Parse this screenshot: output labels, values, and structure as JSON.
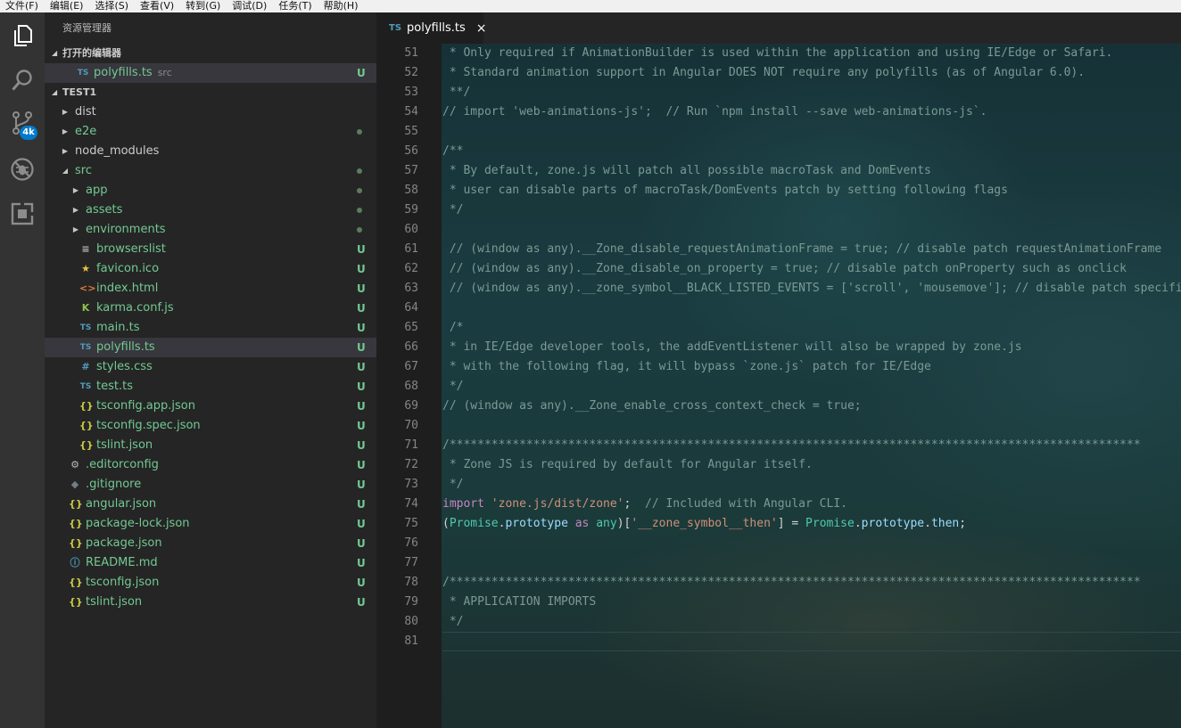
{
  "menu": [
    "文件(F)",
    "编辑(E)",
    "选择(S)",
    "查看(V)",
    "转到(G)",
    "调试(D)",
    "任务(T)",
    "帮助(H)"
  ],
  "activity_bar": {
    "items": [
      {
        "name": "explorer-icon"
      },
      {
        "name": "search-icon"
      },
      {
        "name": "source-control-icon"
      },
      {
        "name": "debug-icon"
      },
      {
        "name": "extensions-icon"
      }
    ],
    "scm_badge": "4k"
  },
  "sidebar": {
    "title": "资源管理器",
    "open_editors": {
      "header": "打开的编辑器",
      "items": [
        {
          "icon": "TS",
          "icon_color": "#519aba",
          "label": "polyfills.ts",
          "desc": "src",
          "status": "U"
        }
      ]
    },
    "folder": {
      "header": "TEST1",
      "items": [
        {
          "kind": "folder",
          "label": "dist",
          "level": 0,
          "expanded": false,
          "status": "",
          "dot": false
        },
        {
          "kind": "folder",
          "label": "e2e",
          "level": 0,
          "expanded": false,
          "status": "",
          "dot": true,
          "color": "#73c991"
        },
        {
          "kind": "folder",
          "label": "node_modules",
          "level": 0,
          "expanded": false,
          "status": "",
          "dot": false
        },
        {
          "kind": "folder",
          "label": "src",
          "level": 0,
          "expanded": true,
          "status": "",
          "dot": true,
          "color": "#73c991"
        },
        {
          "kind": "folder",
          "label": "app",
          "level": 1,
          "expanded": false,
          "status": "",
          "dot": true,
          "color": "#73c991"
        },
        {
          "kind": "folder",
          "label": "assets",
          "level": 1,
          "expanded": false,
          "status": "",
          "dot": true,
          "color": "#73c991"
        },
        {
          "kind": "folder",
          "label": "environments",
          "level": 1,
          "expanded": false,
          "status": "",
          "dot": true,
          "color": "#73c991"
        },
        {
          "kind": "file",
          "icon": "≡",
          "icon_color": "#bbbbbb",
          "icon_name": "list-file-icon",
          "label": "browserslist",
          "level": 1,
          "status": "U",
          "color": "#73c991"
        },
        {
          "kind": "file",
          "icon": "★",
          "icon_color": "#e8c33a",
          "icon_name": "favicon-file-icon",
          "label": "favicon.ico",
          "level": 1,
          "status": "U",
          "color": "#73c991"
        },
        {
          "kind": "file",
          "icon": "<>",
          "icon_color": "#e37933",
          "icon_name": "html-file-icon",
          "label": "index.html",
          "level": 1,
          "status": "U",
          "color": "#73c991"
        },
        {
          "kind": "file",
          "icon": "K",
          "icon_color": "#8dc149",
          "icon_name": "karma-file-icon",
          "label": "karma.conf.js",
          "level": 1,
          "status": "U",
          "color": "#73c991"
        },
        {
          "kind": "file",
          "icon": "TS",
          "icon_color": "#519aba",
          "icon_name": "typescript-file-icon",
          "label": "main.ts",
          "level": 1,
          "status": "U",
          "color": "#73c991"
        },
        {
          "kind": "file",
          "icon": "TS",
          "icon_color": "#519aba",
          "icon_name": "typescript-file-icon",
          "label": "polyfills.ts",
          "level": 1,
          "status": "U",
          "color": "#73c991",
          "selected": true
        },
        {
          "kind": "file",
          "icon": "#",
          "icon_color": "#519aba",
          "icon_name": "css-file-icon",
          "label": "styles.css",
          "level": 1,
          "status": "U",
          "color": "#73c991"
        },
        {
          "kind": "file",
          "icon": "TS",
          "icon_color": "#519aba",
          "icon_name": "typescript-file-icon",
          "label": "test.ts",
          "level": 1,
          "status": "U",
          "color": "#73c991"
        },
        {
          "kind": "file",
          "icon": "{}",
          "icon_color": "#cbcb41",
          "icon_name": "json-file-icon",
          "label": "tsconfig.app.json",
          "level": 1,
          "status": "U",
          "color": "#73c991"
        },
        {
          "kind": "file",
          "icon": "{}",
          "icon_color": "#cbcb41",
          "icon_name": "json-file-icon",
          "label": "tsconfig.spec.json",
          "level": 1,
          "status": "U",
          "color": "#73c991"
        },
        {
          "kind": "file",
          "icon": "{}",
          "icon_color": "#cbcb41",
          "icon_name": "json-file-icon",
          "label": "tslint.json",
          "level": 1,
          "status": "U",
          "color": "#73c991"
        },
        {
          "kind": "file",
          "icon": "⚙",
          "icon_color": "#bbbbbb",
          "icon_name": "gear-file-icon",
          "label": ".editorconfig",
          "level": 0,
          "status": "U",
          "color": "#73c991"
        },
        {
          "kind": "file",
          "icon": "◆",
          "icon_color": "#6d8086",
          "icon_name": "git-file-icon",
          "label": ".gitignore",
          "level": 0,
          "status": "U",
          "color": "#73c991"
        },
        {
          "kind": "file",
          "icon": "{}",
          "icon_color": "#cbcb41",
          "icon_name": "json-file-icon",
          "label": "angular.json",
          "level": 0,
          "status": "U",
          "color": "#73c991"
        },
        {
          "kind": "file",
          "icon": "{}",
          "icon_color": "#cbcb41",
          "icon_name": "json-file-icon",
          "label": "package-lock.json",
          "level": 0,
          "status": "U",
          "color": "#73c991"
        },
        {
          "kind": "file",
          "icon": "{}",
          "icon_color": "#cbcb41",
          "icon_name": "json-file-icon",
          "label": "package.json",
          "level": 0,
          "status": "U",
          "color": "#73c991"
        },
        {
          "kind": "file",
          "icon": "ⓘ",
          "icon_color": "#519aba",
          "icon_name": "info-file-icon",
          "label": "README.md",
          "level": 0,
          "status": "U",
          "color": "#73c991"
        },
        {
          "kind": "file",
          "icon": "{}",
          "icon_color": "#cbcb41",
          "icon_name": "json-file-icon",
          "label": "tsconfig.json",
          "level": 0,
          "status": "U",
          "color": "#73c991"
        },
        {
          "kind": "file",
          "icon": "{}",
          "icon_color": "#cbcb41",
          "icon_name": "json-file-icon",
          "label": "tslint.json",
          "level": 0,
          "status": "U",
          "color": "#73c991"
        }
      ]
    }
  },
  "tabs": [
    {
      "icon": "TS",
      "label": "polyfills.ts",
      "close": "×",
      "active": true
    }
  ],
  "editor": {
    "lines": [
      {
        "n": 51,
        "tokens": [
          {
            "t": " * Only required if AnimationBuilder is used within the application and using IE/Edge or Safari.",
            "c": "com"
          }
        ]
      },
      {
        "n": 52,
        "tokens": [
          {
            "t": " * Standard animation support in Angular DOES NOT require any polyfills (as of Angular 6.0).",
            "c": "com"
          }
        ]
      },
      {
        "n": 53,
        "tokens": [
          {
            "t": " **/",
            "c": "com"
          }
        ]
      },
      {
        "n": 54,
        "tokens": [
          {
            "t": "// import 'web-animations-js';  // Run `npm install --save web-animations-js`.",
            "c": "com"
          }
        ]
      },
      {
        "n": 55,
        "tokens": []
      },
      {
        "n": 56,
        "tokens": [
          {
            "t": "/**",
            "c": "com"
          }
        ]
      },
      {
        "n": 57,
        "tokens": [
          {
            "t": " * By default, zone.js will patch all possible macroTask and DomEvents",
            "c": "com"
          }
        ]
      },
      {
        "n": 58,
        "tokens": [
          {
            "t": " * user can disable parts of macroTask/DomEvents patch by setting following flags",
            "c": "com"
          }
        ]
      },
      {
        "n": 59,
        "tokens": [
          {
            "t": " */",
            "c": "com"
          }
        ]
      },
      {
        "n": 60,
        "tokens": []
      },
      {
        "n": 61,
        "tokens": [
          {
            "t": " // (window as any).__Zone_disable_requestAnimationFrame = true; // disable patch requestAnimationFrame",
            "c": "com"
          }
        ]
      },
      {
        "n": 62,
        "tokens": [
          {
            "t": " // (window as any).__Zone_disable_on_property = true; // disable patch onProperty such as onclick",
            "c": "com"
          }
        ]
      },
      {
        "n": 63,
        "tokens": [
          {
            "t": " // (window as any).__zone_symbol__BLACK_LISTED_EVENTS = ['scroll', 'mousemove']; // disable patch specified eventNames",
            "c": "com"
          }
        ]
      },
      {
        "n": 64,
        "tokens": []
      },
      {
        "n": 65,
        "tokens": [
          {
            "t": " /*",
            "c": "com"
          }
        ]
      },
      {
        "n": 66,
        "tokens": [
          {
            "t": " * in IE/Edge developer tools, the addEventListener will also be wrapped by zone.js",
            "c": "com"
          }
        ]
      },
      {
        "n": 67,
        "tokens": [
          {
            "t": " * with the following flag, it will bypass `zone.js` patch for IE/Edge",
            "c": "com"
          }
        ]
      },
      {
        "n": 68,
        "tokens": [
          {
            "t": " */",
            "c": "com"
          }
        ]
      },
      {
        "n": 69,
        "tokens": [
          {
            "t": "// (window as any).__Zone_enable_cross_context_check = true;",
            "c": "com"
          }
        ]
      },
      {
        "n": 70,
        "tokens": []
      },
      {
        "n": 71,
        "tokens": [
          {
            "t": "/***************************************************************************************************",
            "c": "com"
          }
        ]
      },
      {
        "n": 72,
        "tokens": [
          {
            "t": " * Zone JS is required by default for Angular itself.",
            "c": "com"
          }
        ]
      },
      {
        "n": 73,
        "tokens": [
          {
            "t": " */",
            "c": "com"
          }
        ]
      },
      {
        "n": 74,
        "tokens": [
          {
            "t": "import",
            "c": "kw"
          },
          {
            "t": " ",
            "c": "plain"
          },
          {
            "t": "'zone.js/dist/zone'",
            "c": "str"
          },
          {
            "t": ";  ",
            "c": "plain"
          },
          {
            "t": "// Included with Angular CLI.",
            "c": "com"
          }
        ]
      },
      {
        "n": 75,
        "tokens": [
          {
            "t": "(",
            "c": "plain"
          },
          {
            "t": "Promise",
            "c": "type"
          },
          {
            "t": ".",
            "c": "plain"
          },
          {
            "t": "prototype",
            "c": "prop"
          },
          {
            "t": " ",
            "c": "plain"
          },
          {
            "t": "as",
            "c": "kw"
          },
          {
            "t": " ",
            "c": "plain"
          },
          {
            "t": "any",
            "c": "type"
          },
          {
            "t": ")[",
            "c": "plain"
          },
          {
            "t": "'__zone_symbol__then'",
            "c": "str"
          },
          {
            "t": "] = ",
            "c": "plain"
          },
          {
            "t": "Promise",
            "c": "type"
          },
          {
            "t": ".",
            "c": "plain"
          },
          {
            "t": "prototype",
            "c": "prop"
          },
          {
            "t": ".",
            "c": "plain"
          },
          {
            "t": "then",
            "c": "prop"
          },
          {
            "t": ";",
            "c": "plain"
          }
        ]
      },
      {
        "n": 76,
        "tokens": []
      },
      {
        "n": 77,
        "tokens": []
      },
      {
        "n": 78,
        "tokens": [
          {
            "t": "/***************************************************************************************************",
            "c": "com"
          }
        ]
      },
      {
        "n": 79,
        "tokens": [
          {
            "t": " * APPLICATION IMPORTS",
            "c": "com"
          }
        ]
      },
      {
        "n": 80,
        "tokens": [
          {
            "t": " */",
            "c": "com"
          }
        ]
      },
      {
        "n": 81,
        "tokens": [],
        "current": true
      }
    ]
  }
}
